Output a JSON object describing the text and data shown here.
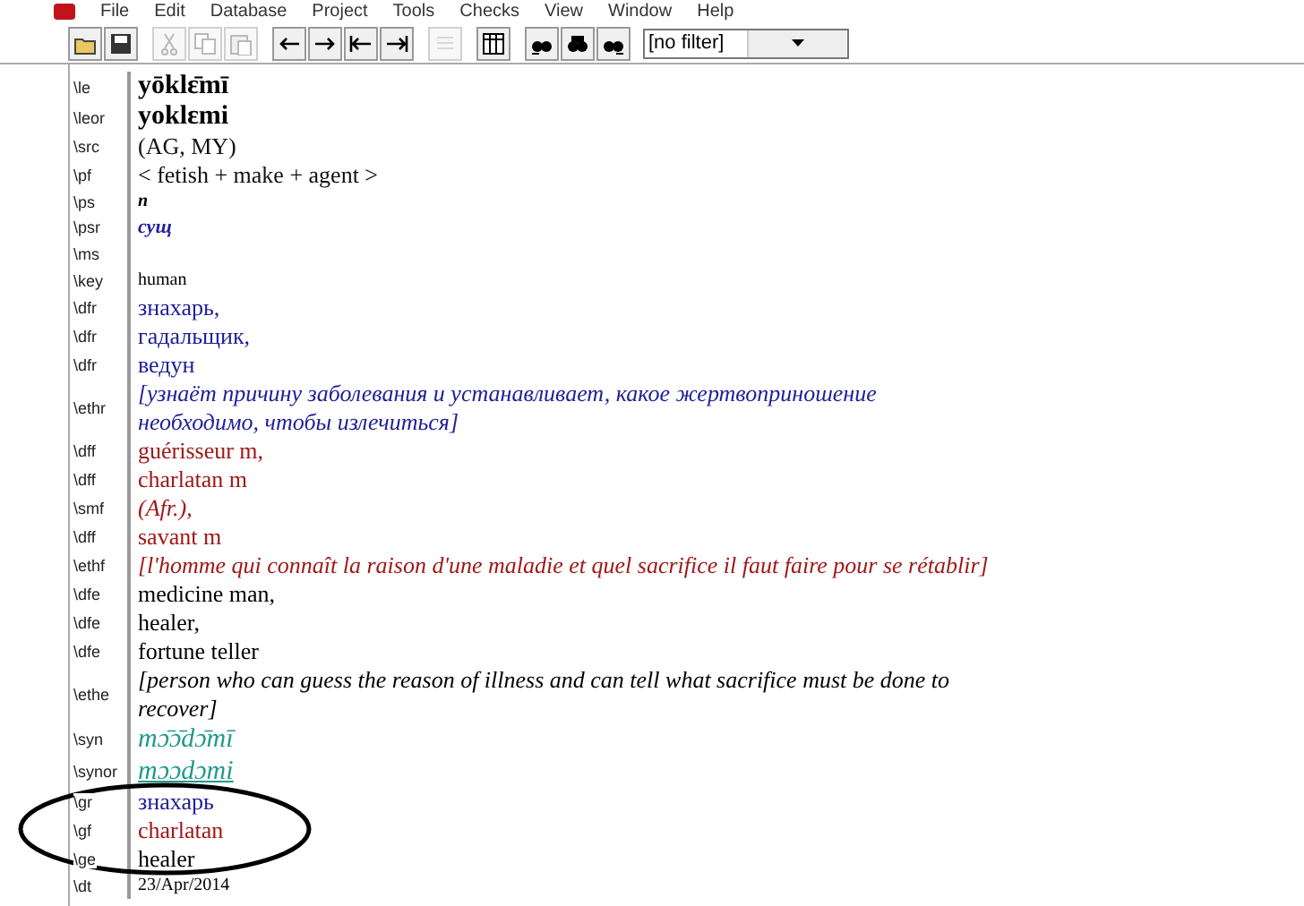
{
  "menu": [
    "File",
    "Edit",
    "Database",
    "Project",
    "Tools",
    "Checks",
    "View",
    "Window",
    "Help"
  ],
  "toolbar": [
    {
      "kind": "open",
      "disabled": false
    },
    {
      "kind": "save",
      "disabled": false
    },
    {
      "kind": "sep"
    },
    {
      "kind": "cut",
      "disabled": true
    },
    {
      "kind": "copy",
      "disabled": true
    },
    {
      "kind": "paste",
      "disabled": true
    },
    {
      "kind": "sep"
    },
    {
      "kind": "prev",
      "disabled": false
    },
    {
      "kind": "next",
      "disabled": false
    },
    {
      "kind": "first",
      "disabled": false
    },
    {
      "kind": "last",
      "disabled": false
    },
    {
      "kind": "sep"
    },
    {
      "kind": "list",
      "disabled": true
    },
    {
      "kind": "sep"
    },
    {
      "kind": "grid",
      "disabled": false
    },
    {
      "kind": "sep"
    },
    {
      "kind": "findprev",
      "disabled": false
    },
    {
      "kind": "find",
      "disabled": false
    },
    {
      "kind": "findnext",
      "disabled": false
    }
  ],
  "filter": {
    "value": "[no filter]"
  },
  "fields": [
    {
      "marker": "\\le",
      "text": "yōklɛ̄mī",
      "kind": "headword"
    },
    {
      "marker": "\\leor",
      "text": "yoklɛmi",
      "kind": "headword"
    },
    {
      "marker": "\\src",
      "text": " (AG, MY)",
      "kind": "plain"
    },
    {
      "marker": "\\pf",
      "text": "< fetish + make + agent >",
      "kind": "plain"
    },
    {
      "marker": "\\ps",
      "text": "n",
      "kind": "pos"
    },
    {
      "marker": "\\psr",
      "text": "сущ",
      "kind": "posru"
    },
    {
      "marker": "\\ms",
      "kind": "plain"
    },
    {
      "marker": "\\key",
      "text": "human",
      "kind": "small"
    },
    {
      "marker": "\\dfr",
      "text": "знахарь,",
      "kind": "russian"
    },
    {
      "marker": "\\dfr",
      "text": "гадальщик,",
      "kind": "russian"
    },
    {
      "marker": "\\dfr",
      "text": "ведун",
      "kind": "russian"
    },
    {
      "marker": "\\ethr",
      "text": "[узнаёт причину заболевания и устанавливает, какое жертвоприношение необходимо, чтобы излечиться]",
      "kind": "russiannote"
    },
    {
      "marker": "\\dff",
      "text": "guérisseur m,",
      "kind": "french"
    },
    {
      "marker": "\\dff",
      "text": "charlatan m",
      "kind": "french"
    },
    {
      "marker": "\\smf",
      "text": "(Afr.),",
      "kind": "frenchnote"
    },
    {
      "marker": "\\dff",
      "text": "savant m",
      "kind": "french"
    },
    {
      "marker": "\\ethf",
      "text": "[l'homme qui connaît la raison d'une maladie et quel sacrifice il faut faire pour se rétablir]",
      "kind": "frenchnote"
    },
    {
      "marker": "\\dfe",
      "text": "medicine man,",
      "kind": "english"
    },
    {
      "marker": "\\dfe",
      "text": "healer,",
      "kind": "english"
    },
    {
      "marker": "\\dfe",
      "text": "fortune teller",
      "kind": "english"
    },
    {
      "marker": "\\ethe",
      "text": "[person who can guess the reason of illness and can tell what sacrifice must be done to recover]",
      "kind": "englishnote"
    },
    {
      "marker": "\\syn",
      "text": "mɔ̄ɔ̄dɔ̄mī",
      "kind": "synonym"
    },
    {
      "marker": "\\synor",
      "text": "mɔɔdɔmi",
      "kind": "link"
    },
    {
      "marker": "\\gr",
      "text": "знахарь",
      "kind": "russian"
    },
    {
      "marker": "\\gf",
      "text": "charlatan",
      "kind": "french"
    },
    {
      "marker": "\\ge",
      "text": "healer",
      "kind": "english"
    },
    {
      "marker": "\\dt",
      "text": "23/Apr/2014",
      "kind": "small"
    }
  ]
}
